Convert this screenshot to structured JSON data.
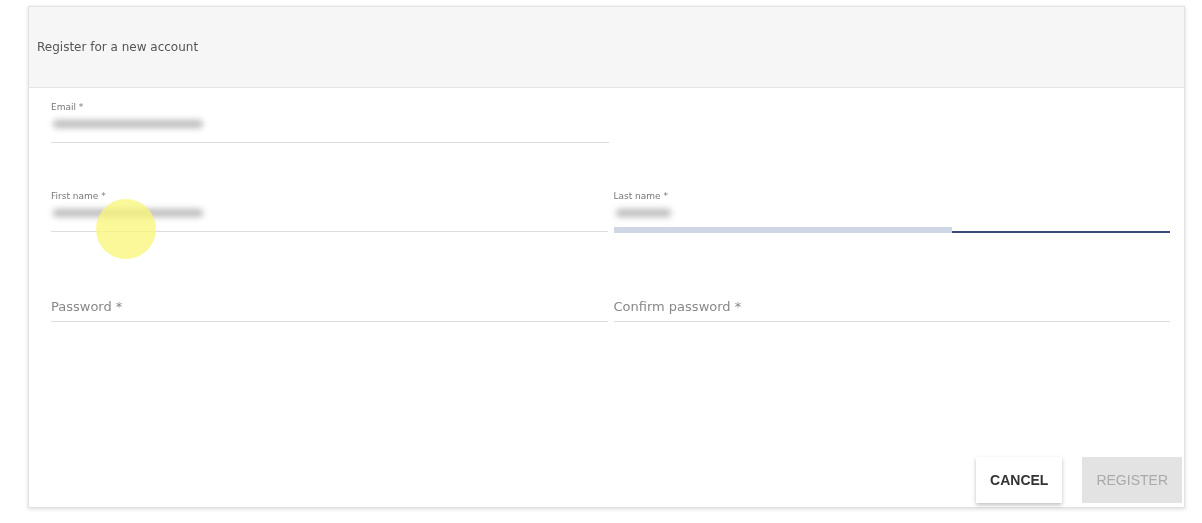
{
  "card": {
    "title": "Register for a new account"
  },
  "rows": [
    [
      {
        "label": "Email *",
        "obscured": true,
        "focused": false,
        "cursor": false
      }
    ],
    [
      {
        "label": "First name *",
        "obscured": true,
        "focused": false,
        "cursor": true
      },
      {
        "label": "Last name *",
        "obscured": true,
        "focused": true,
        "cursor": false
      }
    ],
    [
      {
        "label": "Password *",
        "obscured": false,
        "focused": false,
        "cursor": false
      },
      {
        "label": "Confirm password *",
        "obscured": false,
        "focused": false,
        "cursor": false
      }
    ]
  ],
  "buttons": [
    {
      "label": "CANCEL",
      "disabled": false
    },
    {
      "label": "REGISTER",
      "disabled": true
    }
  ]
}
